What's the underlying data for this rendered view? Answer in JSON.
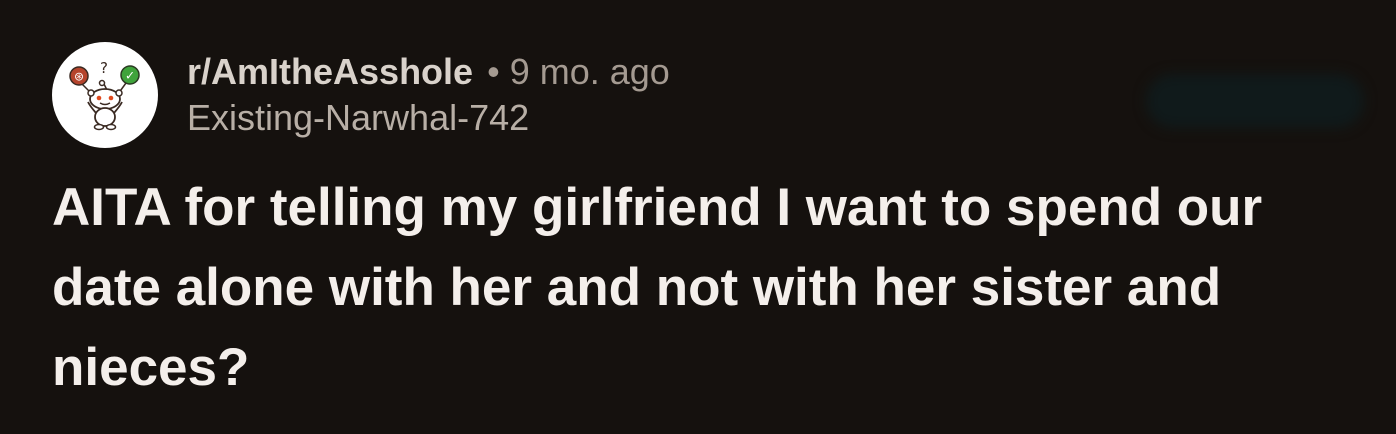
{
  "post": {
    "subreddit": "r/AmItheAsshole",
    "separator": "•",
    "time_ago": "9 mo. ago",
    "author": "Existing-Narwhal-742",
    "title": "AITA for telling my girlfriend I want to spend our date alone with her and not with her sister and nieces?"
  },
  "avatar": {
    "icon": "snoo-icon",
    "badge_left": "⊛",
    "badge_mid": "?",
    "badge_right": "✓"
  },
  "colors": {
    "background": "#15110e",
    "title": "#f4efeb",
    "subreddit": "#d9d2cb",
    "meta": "#a49a91",
    "badge_left": "#b5442c",
    "badge_right": "#3fa33b"
  }
}
